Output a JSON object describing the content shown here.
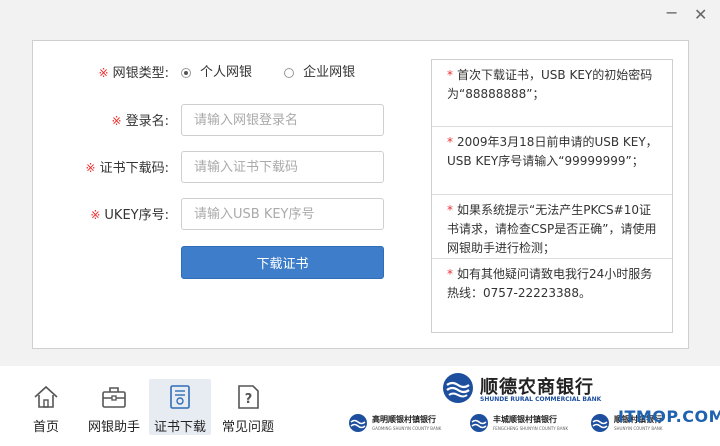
{
  "window": {
    "minimize": "−",
    "close": "✕"
  },
  "form": {
    "bank_type": {
      "required_mark": "※",
      "label": "网银类型:",
      "options": [
        {
          "label": "个人网银",
          "checked": true
        },
        {
          "label": "企业网银",
          "checked": false
        }
      ]
    },
    "login": {
      "required_mark": "※",
      "label": "登录名:",
      "placeholder": "请输入网银登录名"
    },
    "cert_code": {
      "required_mark": "※",
      "label": "证书下载码:",
      "placeholder": "请输入证书下载码"
    },
    "ukey": {
      "required_mark": "※",
      "label": "UKEY序号:",
      "placeholder": "请输入USB KEY序号"
    },
    "submit_label": "下载证书"
  },
  "notes": [
    {
      "star": "*",
      "text": "首次下载证书，USB KEY的初始密码为“88888888”；"
    },
    {
      "star": "*",
      "text": "2009年3月18日前申请的USB KEY，USB KEY序号请输入“99999999”；"
    },
    {
      "star": "*",
      "text": "如果系统提示“无法产生PKCS#10证书请求，请检查CSP是否正确”，请使用网银助手进行检测；"
    },
    {
      "star": "*",
      "text": "如有其他疑问请致电我行24小时服务热线：0757-22223388。"
    }
  ],
  "bottom_nav": [
    {
      "label": "首页",
      "icon": "home-icon",
      "active": false
    },
    {
      "label": "网银助手",
      "icon": "toolbox-icon",
      "active": false
    },
    {
      "label": "证书下载",
      "icon": "certificate-icon",
      "active": true
    },
    {
      "label": "常见问题",
      "icon": "help-document-icon",
      "active": false
    }
  ],
  "brand": {
    "name_cn": "顺德农商银行",
    "name_en": "SHUNDE RURAL COMMERCIAL BANK",
    "color": "#1d4f9e"
  },
  "sub_banks": [
    {
      "name": "高明顺银村镇银行",
      "name_en": "GAOMING SHUNYIN COUNTY BANK"
    },
    {
      "name": "丰城顺银村镇银行",
      "name_en": "FENGCHENG SHUNYIN COUNTY BANK"
    },
    {
      "name": "顺银村镇银行",
      "name_en": "SHUNYIN COUNTY BANK"
    }
  ],
  "watermark": "ITMOP.COM",
  "colors": {
    "primary": "#3d7dc9",
    "required": "#e33333",
    "active_nav": "#e7ecf3",
    "watermark": "#1f63b0"
  }
}
